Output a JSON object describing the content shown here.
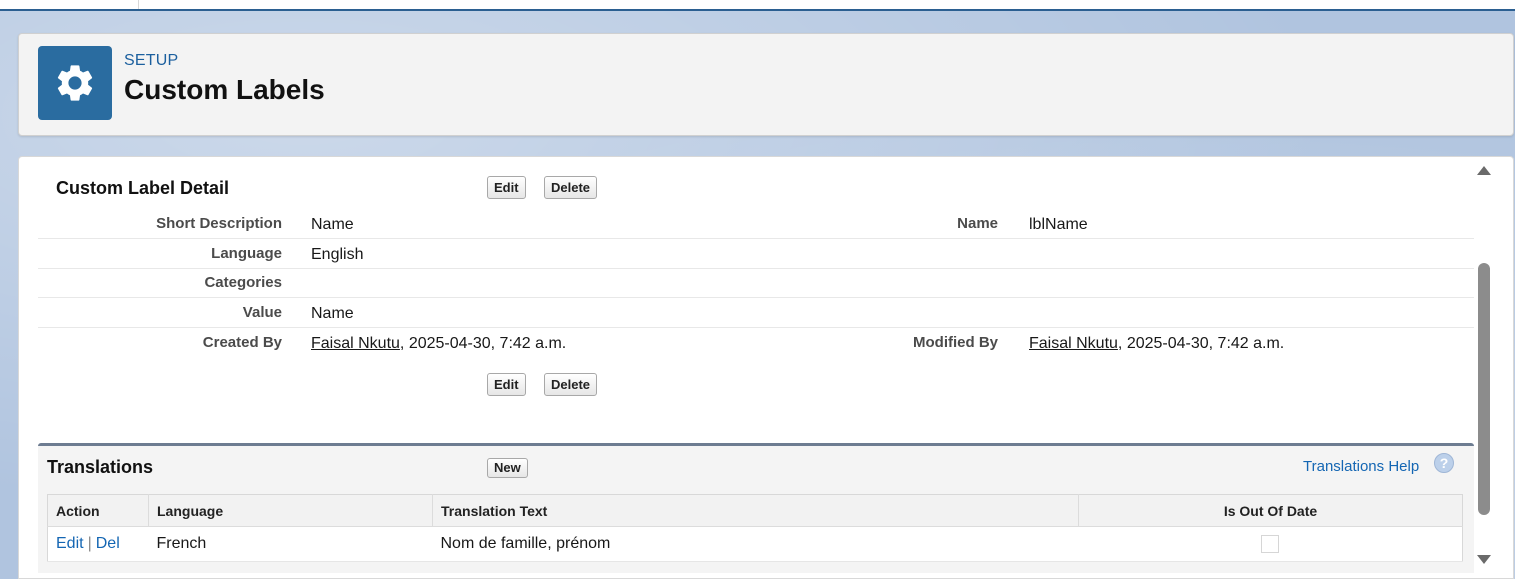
{
  "header": {
    "eyebrow": "SETUP",
    "title": "Custom Labels",
    "icon": "gear-icon",
    "icon_bg": "#2a6ca0"
  },
  "detail": {
    "title": "Custom Label Detail",
    "edit_label": "Edit",
    "delete_label": "Delete",
    "fields": {
      "short_description": {
        "label": "Short Description",
        "value": "Name"
      },
      "name": {
        "label": "Name",
        "value": "lblName"
      },
      "language": {
        "label": "Language",
        "value": "English"
      },
      "categories": {
        "label": "Categories",
        "value": ""
      },
      "value": {
        "label": "Value",
        "value": "Name"
      },
      "created_by": {
        "label": "Created By",
        "user": "Faisal Nkutu",
        "date": ", 2025-04-30, 7:42 a.m."
      },
      "modified_by": {
        "label": "Modified By",
        "user": "Faisal Nkutu",
        "date": ", 2025-04-30, 7:42 a.m."
      }
    }
  },
  "translations": {
    "title": "Translations",
    "new_label": "New",
    "help_label": "Translations Help",
    "help_icon_glyph": "?",
    "columns": {
      "action": "Action",
      "language": "Language",
      "text": "Translation Text",
      "out_of_date": "Is Out Of Date"
    },
    "rows": [
      {
        "edit": "Edit",
        "separator": "|",
        "del": "Del",
        "language": "French",
        "text": "Nom de famille, prénom",
        "out_of_date": false
      }
    ]
  },
  "colors": {
    "link": "#1466b3",
    "brand": "#2a6ca0",
    "panel_border": "#6d7c91"
  }
}
